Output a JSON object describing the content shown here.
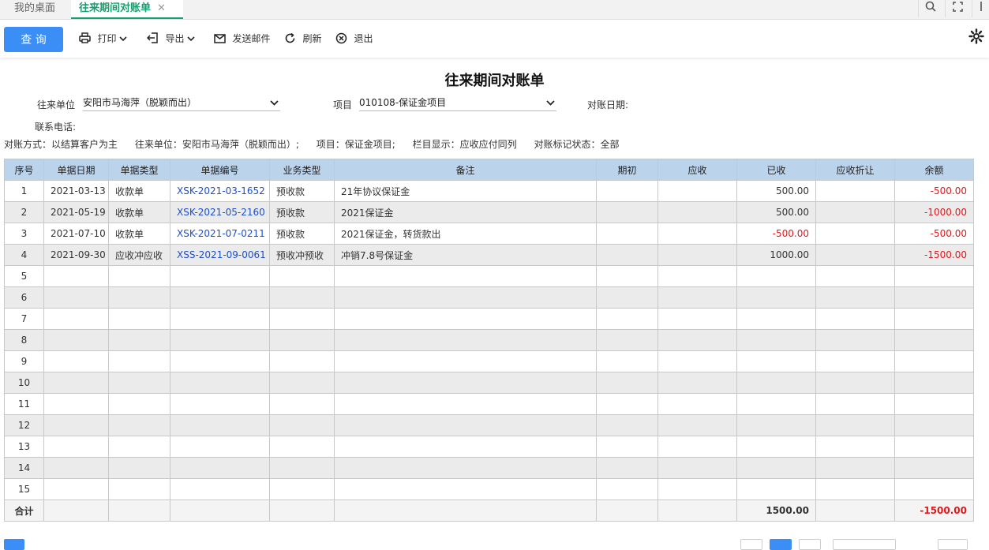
{
  "tabs": [
    {
      "label": "我的桌面"
    },
    {
      "label": "往来期间对账单",
      "close": "✕"
    }
  ],
  "toolbar": {
    "query": "查 询",
    "print": "打印",
    "export": "导出",
    "send_mail": "发送邮件",
    "refresh": "刷新",
    "exit": "退出"
  },
  "report": {
    "title": "往来期间对账单",
    "unit_label": "往来单位",
    "unit_value": "安阳市马海萍（脱颖而出）",
    "project_label": "项目",
    "project_value": "010108-保证金项目",
    "date_label": "对账日期:",
    "phone_label": "联系电话:",
    "info": [
      "对账方式：以结算客户为主",
      "往来单位：安阳市马海萍（脱颖而出）;",
      "项目：保证金项目;",
      "栏目显示：应收应付同列",
      "对账标记状态：全部"
    ]
  },
  "table": {
    "columns": [
      "序号",
      "单据日期",
      "单据类型",
      "单据编号",
      "业务类型",
      "备注",
      "期初",
      "应收",
      "已收",
      "应收折让",
      "余额"
    ],
    "rows": [
      [
        "1",
        "2021-03-13",
        "收款单",
        "XSK-2021-03-1652",
        "预收款",
        "21年协议保证金",
        "",
        "",
        "500.00",
        "",
        "-500.00"
      ],
      [
        "2",
        "2021-05-19",
        "收款单",
        "XSK-2021-05-2160",
        "预收款",
        "2021保证金",
        "",
        "",
        "500.00",
        "",
        "-1000.00"
      ],
      [
        "3",
        "2021-07-10",
        "收款单",
        "XSK-2021-07-0211",
        "预收款",
        "2021保证金，转货款出",
        "",
        "",
        "-500.00",
        "",
        "-500.00"
      ],
      [
        "4",
        "2021-09-30",
        "应收冲应收",
        "XSS-2021-09-0061",
        "预收冲预收",
        "冲销7.8号保证金",
        "",
        "",
        "1000.00",
        "",
        "-1500.00"
      ],
      [
        "5",
        "",
        "",
        "",
        "",
        "",
        "",
        "",
        "",
        "",
        ""
      ],
      [
        "6",
        "",
        "",
        "",
        "",
        "",
        "",
        "",
        "",
        "",
        ""
      ],
      [
        "7",
        "",
        "",
        "",
        "",
        "",
        "",
        "",
        "",
        "",
        ""
      ],
      [
        "8",
        "",
        "",
        "",
        "",
        "",
        "",
        "",
        "",
        "",
        ""
      ],
      [
        "9",
        "",
        "",
        "",
        "",
        "",
        "",
        "",
        "",
        "",
        ""
      ],
      [
        "10",
        "",
        "",
        "",
        "",
        "",
        "",
        "",
        "",
        "",
        ""
      ],
      [
        "11",
        "",
        "",
        "",
        "",
        "",
        "",
        "",
        "",
        "",
        ""
      ],
      [
        "12",
        "",
        "",
        "",
        "",
        "",
        "",
        "",
        "",
        "",
        ""
      ],
      [
        "13",
        "",
        "",
        "",
        "",
        "",
        "",
        "",
        "",
        "",
        ""
      ],
      [
        "14",
        "",
        "",
        "",
        "",
        "",
        "",
        "",
        "",
        "",
        ""
      ],
      [
        "15",
        "",
        "",
        "",
        "",
        "",
        "",
        "",
        "",
        "",
        ""
      ]
    ],
    "total": {
      "label": "合计",
      "received": "1500.00",
      "balance": "-1500.00"
    }
  },
  "colors": {
    "accent": "#3a8ef6",
    "tab_active": "#1a9e6f",
    "header_bg": "#bcd3ec",
    "link": "#1c4fc9",
    "negative": "#e0191d"
  }
}
